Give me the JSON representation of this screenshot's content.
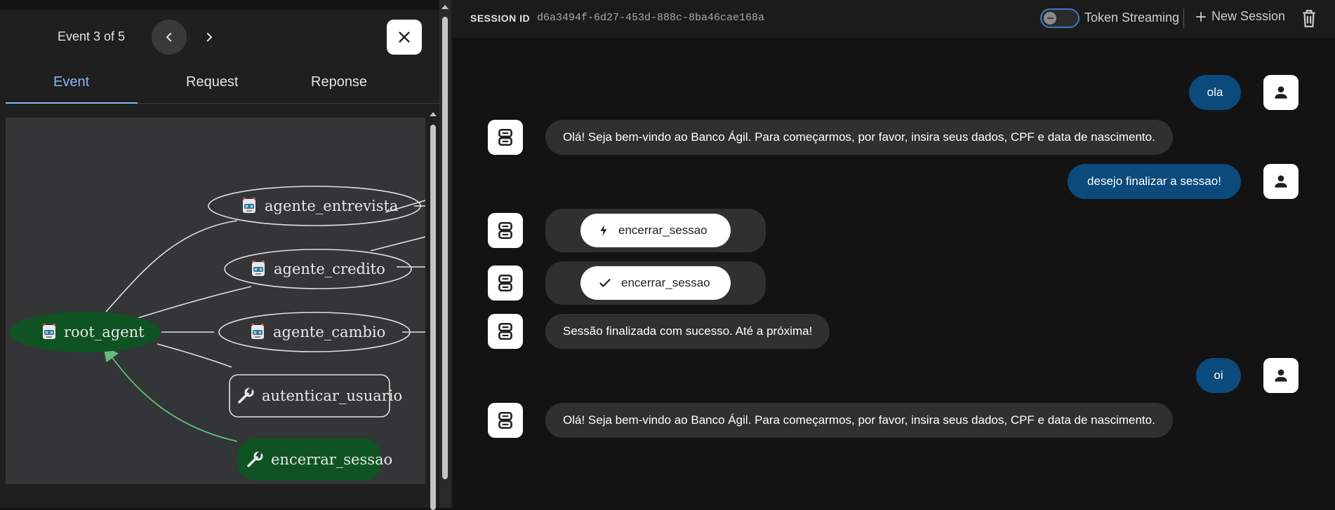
{
  "event_panel": {
    "counter": "Event 3 of 5",
    "tabs": [
      {
        "label": "Event",
        "active": true
      },
      {
        "label": "Request",
        "active": false
      },
      {
        "label": "Reponse",
        "active": false
      }
    ],
    "graph": {
      "nodes": [
        {
          "label": "agente_entrevista",
          "kind": "agent",
          "highlighted": false
        },
        {
          "label": "agente_credito",
          "kind": "agent",
          "highlighted": false
        },
        {
          "label": "root_agent",
          "kind": "agent",
          "highlighted": true
        },
        {
          "label": "agente_cambio",
          "kind": "agent",
          "highlighted": false
        },
        {
          "label": "autenticar_usuario",
          "kind": "tool",
          "highlighted": false
        },
        {
          "label": "encerrar_sessao",
          "kind": "tool",
          "highlighted": true
        }
      ],
      "highlight_color": "#0f5323",
      "edge_highlight_color": "#5fbf7a"
    }
  },
  "topbar": {
    "session_label": "SESSION ID",
    "session_id": "d6a3494f-6d27-453d-888c-8ba46cae168a",
    "token_streaming_label": "Token Streaming",
    "token_streaming_on": false,
    "new_session_label": "New Session"
  },
  "chat": {
    "messages": [
      {
        "role": "user",
        "text": "ola"
      },
      {
        "role": "bot",
        "text": "Olá! Seja bem-vindo ao Banco Ágil. Para começarmos, por favor, insira seus dados, CPF e data de nascimento."
      },
      {
        "role": "user",
        "text": "desejo finalizar a sessao!"
      },
      {
        "role": "tool_call",
        "text": "encerrar_sessao",
        "icon": "bolt-icon"
      },
      {
        "role": "tool_result",
        "text": "encerrar_sessao",
        "icon": "check-icon"
      },
      {
        "role": "bot",
        "text": "Sessão finalizada com sucesso. Até a próxima!"
      },
      {
        "role": "user",
        "text": "oi"
      },
      {
        "role": "bot",
        "text": "Olá! Seja bem-vindo ao Banco Ágil. Para começarmos, por favor, insira seus dados, CPF e data de nascimento."
      }
    ],
    "user_bubble_color": "#0b4a7b",
    "bot_bubble_color": "#303030"
  }
}
